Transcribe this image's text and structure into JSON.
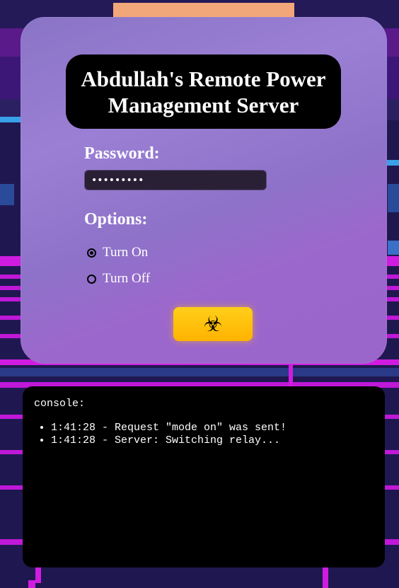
{
  "form": {
    "title": "Abdullah's Remote Power Management Server",
    "password_label": "Password:",
    "password_value": "•••••••••",
    "options_label": "Options:",
    "options": [
      {
        "label": "Turn On",
        "selected": true
      },
      {
        "label": "Turn Off",
        "selected": false
      }
    ],
    "submit_icon": "biohazard-icon",
    "submit_glyph": "☣"
  },
  "console": {
    "title": "console:",
    "lines": [
      "1:41:28 - Request \"mode on\" was sent!",
      "1:41:28 - Server: Switching relay..."
    ]
  },
  "colors": {
    "accent_button": "#ffc107",
    "card": "#9b7fd4",
    "console_bg": "#000000"
  }
}
